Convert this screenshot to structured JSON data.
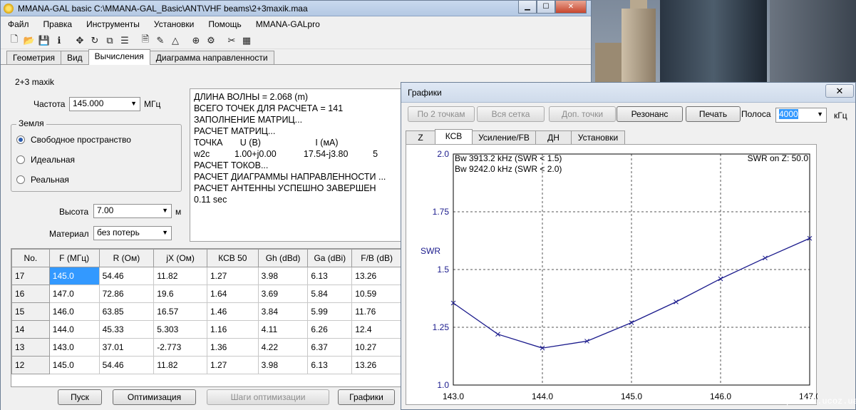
{
  "main": {
    "title": "MMANA-GAL basic C:\\MMANA-GAL_Basic\\ANT\\VHF beams\\2+3maxik.maa",
    "menu": [
      "Файл",
      "Правка",
      "Инструменты",
      "Установки",
      "Помощь",
      "MMANA-GALpro"
    ],
    "tabs": [
      "Геометрия",
      "Вид",
      "Вычисления",
      "Диаграмма направленности"
    ],
    "antenna_name": "2+3 maxik",
    "freq_label": "Частота",
    "freq_value": "145.000",
    "freq_unit": "МГц",
    "ground_label": "Земля",
    "ground_options": [
      "Свободное пространство",
      "Идеальная",
      "Реальная"
    ],
    "height_label": "Высота",
    "height_value": "7.00",
    "height_unit": "м",
    "material_label": "Материал",
    "material_value": "без потерь",
    "log": [
      "ДЛИНА ВОЛНЫ = 2.068 (m)",
      "ВСЕГО ТОЧЕК ДЛЯ РАСЧЕТА = 141",
      "ЗАПОЛНЕНИЕ МАТРИЦ...",
      "РАСЧЕТ МАТРИЦ...",
      "ТОЧКА       U (В)                      I (мА)                   ",
      "w2c          1.00+j0.00           17.54-j3.80          5",
      "РАСЧЕТ ТОКОВ...",
      "РАСЧЕТ ДИАГРАММЫ НАПРАВЛЕННОСТИ ...",
      "РАСЧЕТ АНТЕННЫ УСПЕШНО ЗАВЕРШЕН",
      "0.11 sec"
    ],
    "table": {
      "headers": [
        "No.",
        "F (МГц)",
        "R (Ом)",
        "jX (Ом)",
        "КСВ 50",
        "Gh (dBd)",
        "Ga (dBi)",
        "F/B (dB)"
      ],
      "rows": [
        [
          "17",
          "145.0",
          "54.46",
          "11.82",
          "1.27",
          "3.98",
          "6.13",
          "13.26"
        ],
        [
          "16",
          "147.0",
          "72.86",
          "19.6",
          "1.64",
          "3.69",
          "5.84",
          "10.59"
        ],
        [
          "15",
          "146.0",
          "63.85",
          "16.57",
          "1.46",
          "3.84",
          "5.99",
          "11.76"
        ],
        [
          "14",
          "144.0",
          "45.33",
          "5.303",
          "1.16",
          "4.11",
          "6.26",
          "12.4"
        ],
        [
          "13",
          "143.0",
          "37.01",
          "-2.773",
          "1.36",
          "4.22",
          "6.37",
          "10.27"
        ],
        [
          "12",
          "145.0",
          "54.46",
          "11.82",
          "1.27",
          "3.98",
          "6.13",
          "13.26"
        ]
      ]
    },
    "buttons": {
      "start": "Пуск",
      "optimize": "Оптимизация",
      "opt_steps": "Шаги оптимизации",
      "graphs": "Графики"
    },
    "colors": {
      "selection": "#3399ff",
      "chart_line": "#1a1a8c"
    }
  },
  "graphs": {
    "title": "Графики",
    "close_glyph": "✕",
    "buttons": [
      "По 2 точкам",
      "Вся сетка",
      "Доп. точки",
      "Резонанс",
      "Печать"
    ],
    "band_label": "Полоса",
    "band_value": "4000",
    "band_unit": "кГц",
    "tabs": [
      "Z",
      "КСВ",
      "Усиление/FB",
      "ДН",
      "Установки"
    ],
    "watermark": "radioproffi.ucoz.ua"
  },
  "chart_data": {
    "type": "line",
    "ylabel": "SWR",
    "annotations": [
      "Bw 3913.2 kHz (SWR < 1.5)",
      "Bw 9242.0 kHz (SWR < 2.0)",
      "SWR on Z: 50.0"
    ],
    "x_ticks": [
      "143.0",
      "144.0",
      "145.0",
      "146.0",
      "147.0"
    ],
    "y_ticks": [
      "2.0",
      "1.75",
      "1.5",
      "1.25",
      "1.0"
    ],
    "xlim": [
      143.0,
      147.0
    ],
    "ylim": [
      1.0,
      2.0
    ],
    "grid": true,
    "x": [
      143.0,
      143.5,
      144.0,
      144.5,
      145.0,
      145.5,
      146.0,
      146.5,
      147.0
    ],
    "values": [
      1.355,
      1.22,
      1.16,
      1.19,
      1.27,
      1.36,
      1.46,
      1.55,
      1.635
    ]
  }
}
